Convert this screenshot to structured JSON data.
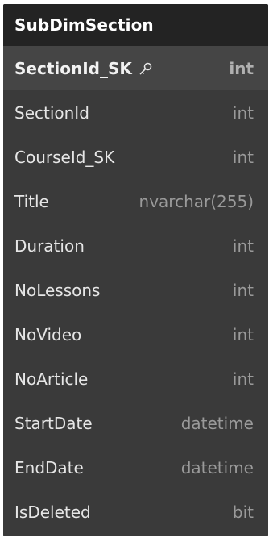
{
  "table": {
    "name": "SubDimSection",
    "columns": [
      {
        "name": "SectionId_SK",
        "type": "int",
        "primary_key": true,
        "icon": "key-icon"
      },
      {
        "name": "SectionId",
        "type": "int"
      },
      {
        "name": "CourseId_SK",
        "type": "int"
      },
      {
        "name": "Title",
        "type": "nvarchar(255)"
      },
      {
        "name": "Duration",
        "type": "int"
      },
      {
        "name": "NoLessons",
        "type": "int"
      },
      {
        "name": "NoVideo",
        "type": "int"
      },
      {
        "name": "NoArticle",
        "type": "int"
      },
      {
        "name": "StartDate",
        "type": "datetime"
      },
      {
        "name": "EndDate",
        "type": "datetime"
      },
      {
        "name": "IsDeleted",
        "type": "bit"
      }
    ]
  },
  "colors": {
    "header_bg": "#232323",
    "body_bg": "#3a3a3a",
    "pk_row_bg": "#454545",
    "name_text": "#e6e6e6",
    "type_text": "#9a9a9a"
  }
}
